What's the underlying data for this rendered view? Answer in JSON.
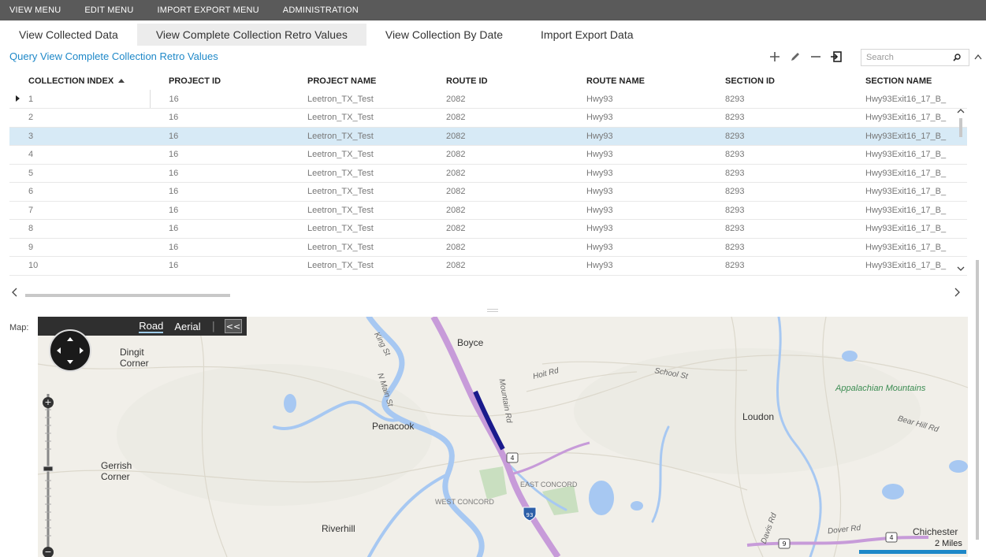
{
  "menubar": {
    "items": [
      "VIEW MENU",
      "EDIT MENU",
      "IMPORT EXPORT MENU",
      "ADMINISTRATION"
    ]
  },
  "tabs": [
    {
      "label": "View Collected Data",
      "active": false
    },
    {
      "label": "View Complete Collection Retro Values",
      "active": true
    },
    {
      "label": "View Collection By Date",
      "active": false
    },
    {
      "label": "Import Export Data",
      "active": false
    }
  ],
  "query": {
    "title": "Query View Complete Collection Retro Values"
  },
  "toolbar": {
    "add_icon": "plus-icon",
    "edit_icon": "pencil-icon",
    "delete_icon": "minus-icon",
    "export_icon": "export-icon",
    "search_placeholder": "Search",
    "search_icon": "magnifier-icon"
  },
  "grid": {
    "columns": [
      "COLLECTION INDEX",
      "PROJECT ID",
      "PROJECT NAME",
      "ROUTE ID",
      "ROUTE NAME",
      "SECTION ID",
      "SECTION NAME"
    ],
    "sorted_column": "COLLECTION INDEX",
    "rows": [
      [
        "1",
        "16",
        "Leetron_TX_Test",
        "2082",
        "Hwy93",
        "8293",
        "Hwy93Exit16_17_B_"
      ],
      [
        "2",
        "16",
        "Leetron_TX_Test",
        "2082",
        "Hwy93",
        "8293",
        "Hwy93Exit16_17_B_"
      ],
      [
        "3",
        "16",
        "Leetron_TX_Test",
        "2082",
        "Hwy93",
        "8293",
        "Hwy93Exit16_17_B_"
      ],
      [
        "4",
        "16",
        "Leetron_TX_Test",
        "2082",
        "Hwy93",
        "8293",
        "Hwy93Exit16_17_B_"
      ],
      [
        "5",
        "16",
        "Leetron_TX_Test",
        "2082",
        "Hwy93",
        "8293",
        "Hwy93Exit16_17_B_"
      ],
      [
        "6",
        "16",
        "Leetron_TX_Test",
        "2082",
        "Hwy93",
        "8293",
        "Hwy93Exit16_17_B_"
      ],
      [
        "7",
        "16",
        "Leetron_TX_Test",
        "2082",
        "Hwy93",
        "8293",
        "Hwy93Exit16_17_B_"
      ],
      [
        "8",
        "16",
        "Leetron_TX_Test",
        "2082",
        "Hwy93",
        "8293",
        "Hwy93Exit16_17_B_"
      ],
      [
        "9",
        "16",
        "Leetron_TX_Test",
        "2082",
        "Hwy93",
        "8293",
        "Hwy93Exit16_17_B_"
      ],
      [
        "10",
        "16",
        "Leetron_TX_Test",
        "2082",
        "Hwy93",
        "8293",
        "Hwy93Exit16_17_B_"
      ]
    ],
    "selected_row": 2,
    "current_row": 0
  },
  "map": {
    "label": "Map:",
    "modes": [
      "Road",
      "Aerial"
    ],
    "active_mode": "Road",
    "separator": "|",
    "collapse_label": "<<",
    "places": {
      "dingit": "Dingit\nCorner",
      "boyce": "Boyce",
      "penacook": "Penacook",
      "loudon": "Loudon",
      "gerrish": "Gerrish\nCorner",
      "riverhill": "Riverhill",
      "chichester": "Chichester",
      "east_concord": "EAST CONCORD",
      "west_concord": "WEST CONCORD",
      "appalachian": "Appalachian Mountains",
      "king_st": "King St",
      "n_main_st": "N Main St",
      "mountain_rd": "Mountain Rd",
      "hoit_rd": "Hoit Rd",
      "school_st": "School St",
      "bear_hill_rd": "Bear Hill Rd",
      "dover_rd": "Dover Rd",
      "davis_rd": "Davis Rd"
    },
    "shields": {
      "route4": "4",
      "i93": "93",
      "route9": "9"
    },
    "scale_label": "2 Miles",
    "colors": {
      "highway": "#c79bd9",
      "highlight": "#1a1a8c",
      "water": "#a7c8f2",
      "park": "#c9dfc0",
      "land": "#f1efe9"
    }
  },
  "colors": {
    "accent": "#1e88c8",
    "menubar": "#5a5a5a",
    "selected_row": "#d7eaf6"
  }
}
